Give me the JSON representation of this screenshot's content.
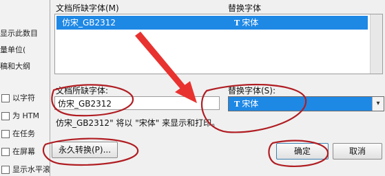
{
  "background_panel": {
    "items": [
      "显示此数目",
      "量单位(",
      "稿和大纲",
      "以字符",
      "为 HTM",
      "在任务",
      "在屏幕",
      "显示水平滚动条(Z)"
    ]
  },
  "dialog": {
    "list_header_doc_font": "文档所缺字体(M)",
    "list_header_sub_font": "替换字体",
    "list_row": {
      "missing_font": "仿宋_GB2312",
      "sub_font": "宋体",
      "glyph": "T"
    },
    "missing_font_label": "文档所缺字体:",
    "missing_font_value": "仿宋_GB2312",
    "sub_font_label": "替换字体(S):",
    "sub_font_value": "宋体",
    "combo_arrow": "▾",
    "info_text": "仿宋_GB2312\" 将以 \"宋体\" 来显示和打印。",
    "permanent_button": "永久转换(P)...",
    "ok_button": "确定",
    "cancel_button": "取消"
  },
  "colors": {
    "accent": "#1e88e5",
    "annotation_red": "#b01d22",
    "arrow_red": "#e8322f"
  }
}
